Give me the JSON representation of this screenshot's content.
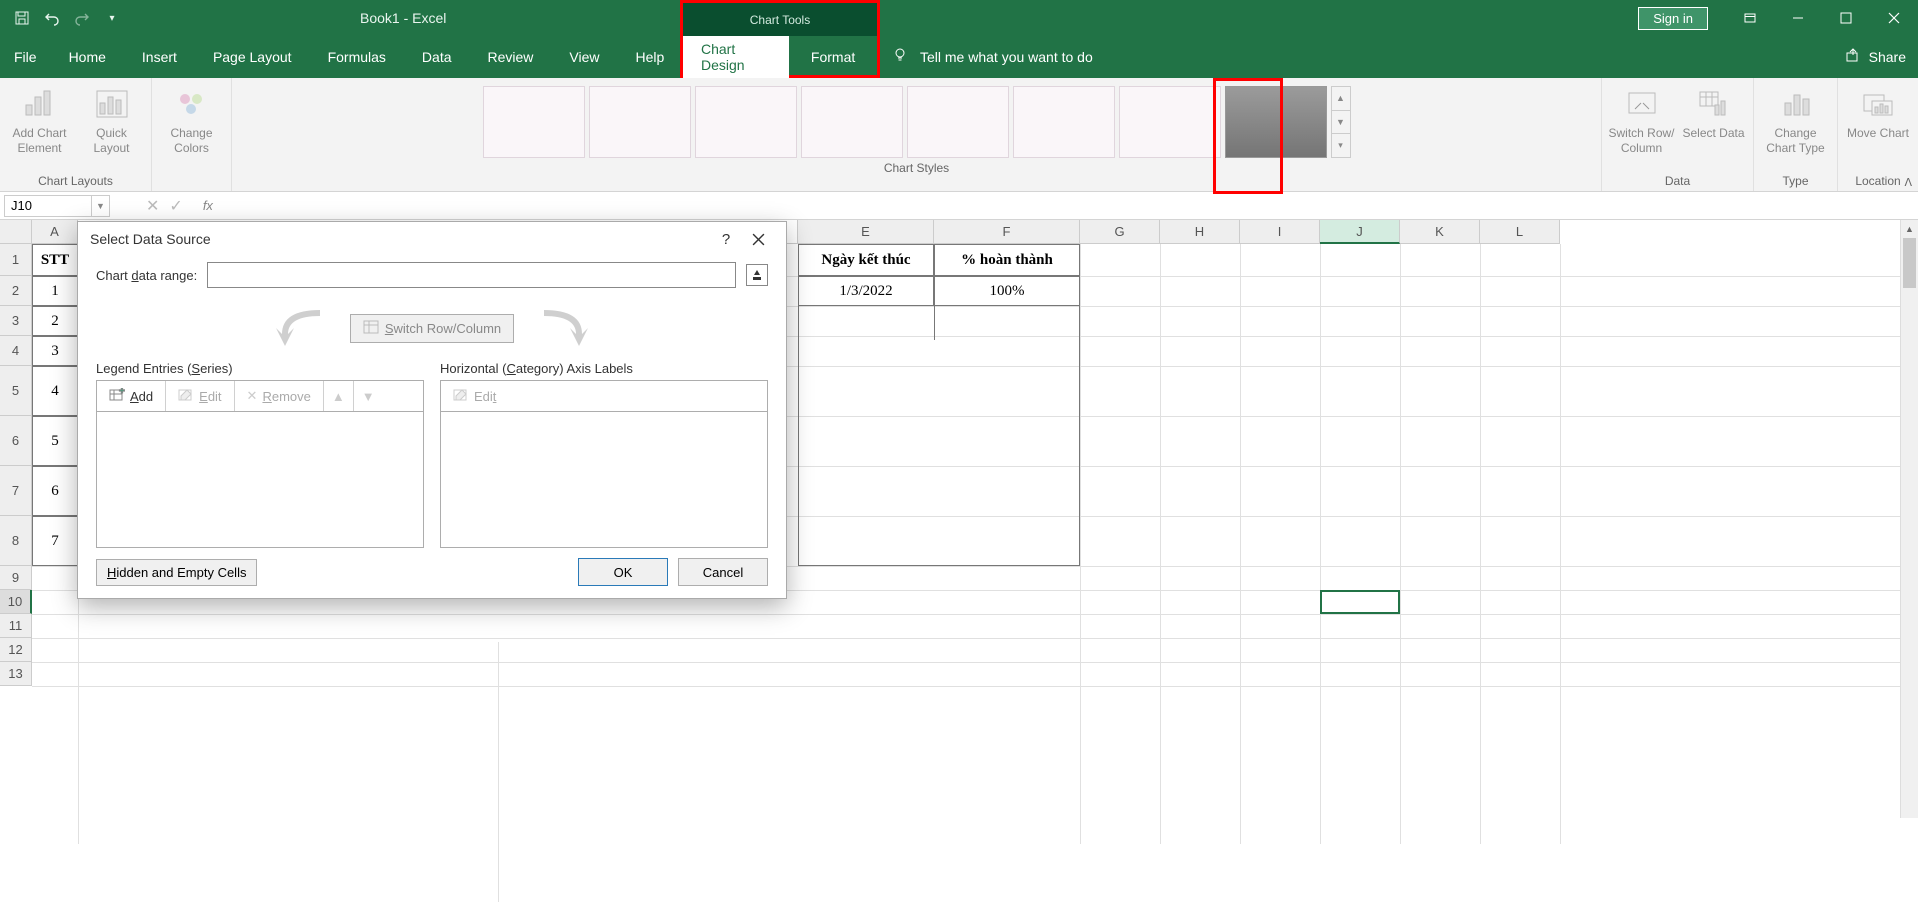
{
  "titlebar": {
    "title": "Book1  -  Excel",
    "chartToolsLabel": "Chart Tools",
    "signIn": "Sign in"
  },
  "tabs": {
    "file": "File",
    "home": "Home",
    "insert": "Insert",
    "pageLayout": "Page Layout",
    "formulas": "Formulas",
    "data": "Data",
    "review": "Review",
    "view": "View",
    "help": "Help",
    "chartDesign": "Chart Design",
    "format": "Format",
    "tellMe": "Tell me what you want to do",
    "share": "Share"
  },
  "ribbon": {
    "addChartElement": "Add Chart Element",
    "quickLayout": "Quick Layout",
    "chartLayouts": "Chart Layouts",
    "changeColors": "Change Colors",
    "chartStyles": "Chart Styles",
    "switchRowCol": "Switch Row/ Column",
    "selectData": "Select Data",
    "dataGroup": "Data",
    "changeChartType": "Change Chart Type",
    "typeGroup": "Type",
    "moveChart": "Move Chart",
    "locationGroup": "Location"
  },
  "formulabar": {
    "nameBox": "J10",
    "fx": "fx"
  },
  "sheet": {
    "cols": [
      "A",
      "E",
      "F",
      "G",
      "H",
      "I",
      "J",
      "K",
      "L"
    ],
    "rowNumbers": [
      1,
      2,
      3,
      4,
      5,
      6,
      7,
      8,
      9,
      10,
      11,
      12,
      13
    ],
    "header_A": "STT",
    "header_E": "Ngày kết thúc",
    "header_F": "% hoàn thành",
    "row2_A": "1",
    "row2_E": "1/3/2022",
    "row2_F": "100%",
    "row3_A": "2",
    "row4_A": "3",
    "row5_A": "4",
    "row6_A": "5",
    "row7_A": "6",
    "row8_A": "7"
  },
  "dialog": {
    "title": "Select Data Source",
    "chartDataRange": "Chart data range:",
    "switchRowCol": "Switch Row/Column",
    "legendEntries": "Legend Entries (Series)",
    "horizontalAxis": "Horizontal (Category) Axis Labels",
    "add": "Add",
    "edit": "Edit",
    "remove": "Remove",
    "hiddenEmpty": "Hidden and Empty Cells",
    "ok": "OK",
    "cancel": "Cancel",
    "help": "?",
    "rangeValue": ""
  }
}
